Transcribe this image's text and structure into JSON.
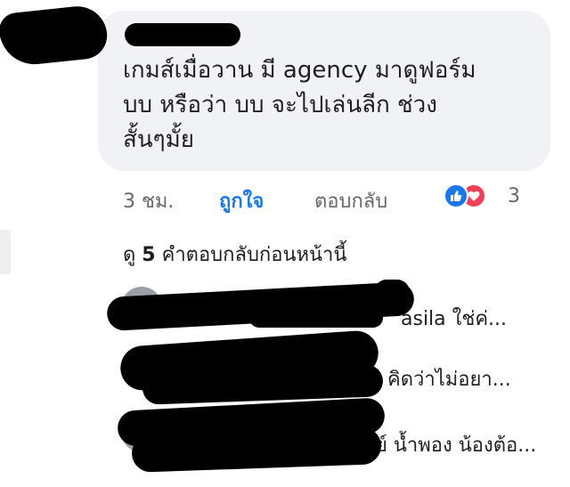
{
  "comment": {
    "text": "เกมส์เมื่อวาน มี agency มาดูฟอร์ม\nบบ หรือว่า บบ จะไปเล่นลีก ช่วง\nสั้นๆมั้ย",
    "actions": {
      "time": "3 ชม.",
      "like": "ถูกใจ",
      "reply": "ตอบกลับ"
    },
    "reactions": {
      "icons": [
        "thumbs-up-icon",
        "heart-icon"
      ],
      "count": "3",
      "colors": {
        "like": "#1877f2",
        "love": "#f33e58"
      }
    }
  },
  "view_previous": {
    "prefix": "ดู",
    "count": "5",
    "suffix": "คำตอบกลับก่อนหน้านี้"
  },
  "replies": [
    {
      "visible_text": "asila ใช่ค่..."
    },
    {
      "visible_text": "คิดว่าไม่อยา..."
    },
    {
      "visible_text": "ย์ น้ำพอง น้องต้อ..."
    }
  ],
  "theme": {
    "bubble_bg": "#f0f2f5",
    "link_blue": "#1877f2",
    "secondary_text": "#65676b"
  }
}
